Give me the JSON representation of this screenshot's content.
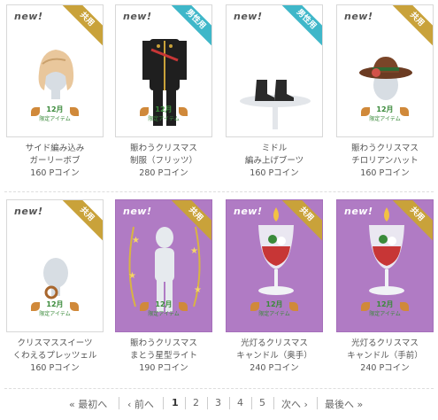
{
  "badges": {
    "new": "new!",
    "shared": "共用",
    "male": "男性用"
  },
  "limited_tag": {
    "month": "12月",
    "label": "限定アイテム"
  },
  "items": [
    {
      "line1": "サイド編み込み",
      "line2": "ガーリーボブ",
      "price": "160 Pコイン",
      "badge": "共用",
      "badge_color": "#c9a23a"
    },
    {
      "line1": "賑わうクリスマス",
      "line2": "制服（フリッツ）",
      "price": "280 Pコイン",
      "badge": "男性用",
      "badge_color": "#3fb7c9"
    },
    {
      "line1": "ミドル",
      "line2": "編み上げブーツ",
      "price": "160 Pコイン",
      "badge": "男性用",
      "badge_color": "#3fb7c9"
    },
    {
      "line1": "賑わうクリスマス",
      "line2": "チロリアンハット",
      "price": "160 Pコイン",
      "badge": "共用",
      "badge_color": "#c9a23a"
    },
    {
      "line1": "クリスマススイーツ",
      "line2": "くわえるプレッツェル",
      "price": "160 Pコイン",
      "badge": "共用",
      "badge_color": "#c9a23a"
    },
    {
      "line1": "賑わうクリスマス",
      "line2": "まとう星型ライト",
      "price": "190 Pコイン",
      "badge": "共用",
      "badge_color": "#c9a23a"
    },
    {
      "line1": "光灯るクリスマス",
      "line2": "キャンドル（奥手）",
      "price": "240 Pコイン",
      "badge": "共用",
      "badge_color": "#c9a23a"
    },
    {
      "line1": "光灯るクリスマス",
      "line2": "キャンドル（手前）",
      "price": "240 Pコイン",
      "badge": "共用",
      "badge_color": "#c9a23a"
    }
  ],
  "pagination": {
    "first": "« 最初へ",
    "prev": "‹ 前へ",
    "pages": [
      "1",
      "2",
      "3",
      "4",
      "5"
    ],
    "current": "1",
    "next": "次へ ›",
    "last": "最後へ »"
  }
}
